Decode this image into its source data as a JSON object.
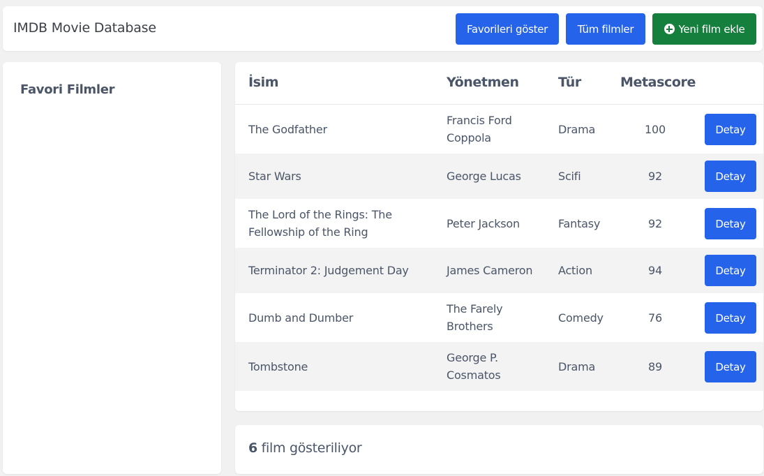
{
  "header": {
    "title": "IMDB Movie Database",
    "show_favorites_label": "Favorileri göster",
    "all_movies_label": "Tüm filmler",
    "add_movie_label": "Yeni film ekle",
    "add_movie_icon": "plus-circle-icon"
  },
  "colors": {
    "primary": "#2563eb",
    "success": "#15803d",
    "text": "#4a5568",
    "background": "#f1f1f1"
  },
  "sidebar": {
    "title": "Favori Filmler"
  },
  "table": {
    "columns": [
      "İsim",
      "Yönetmen",
      "Tür",
      "Metascore"
    ],
    "detail_label": "Detay",
    "rows": [
      {
        "name": "The Godfather",
        "director": "Francis Ford Coppola",
        "genre": "Drama",
        "metascore": "100"
      },
      {
        "name": "Star Wars",
        "director": "George Lucas",
        "genre": "Scifi",
        "metascore": "92"
      },
      {
        "name": "The Lord of the Rings: The Fellowship of the Ring",
        "director": "Peter Jackson",
        "genre": "Fantasy",
        "metascore": "92"
      },
      {
        "name": "Terminator 2: Judgement Day",
        "director": "James Cameron",
        "genre": "Action",
        "metascore": "94"
      },
      {
        "name": "Dumb and Dumber",
        "director": "The Farely Brothers",
        "genre": "Comedy",
        "metascore": "76"
      },
      {
        "name": "Tombstone",
        "director": "George P. Cosmatos",
        "genre": "Drama",
        "metascore": "89"
      }
    ]
  },
  "footer": {
    "count": "6",
    "text": " film gösteriliyor"
  }
}
